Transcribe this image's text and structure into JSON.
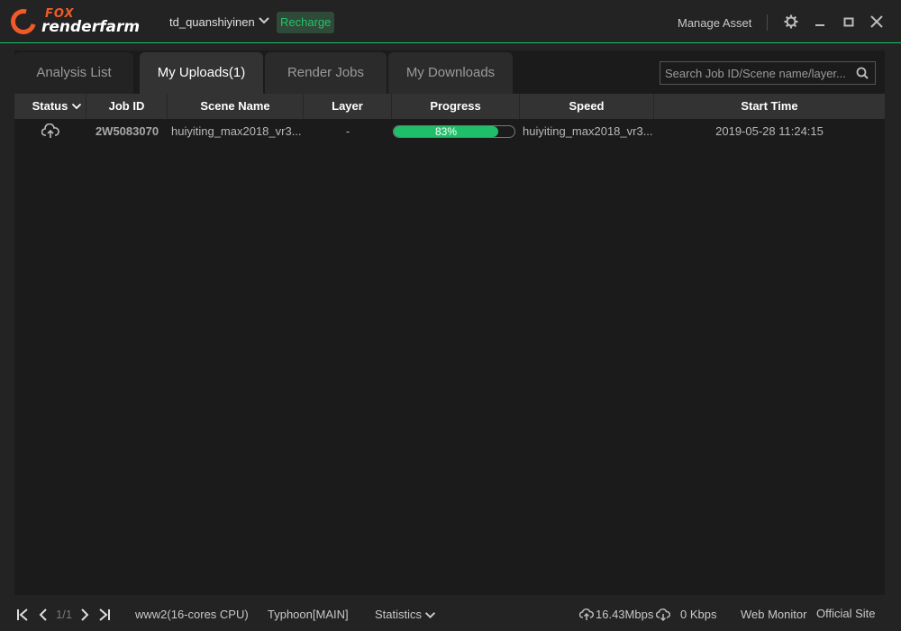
{
  "header": {
    "logo_top": "FOX",
    "logo_bottom": "renderfarm",
    "username": "td_quanshiyinen",
    "recharge_label": "Recharge",
    "manage_asset_label": "Manage Asset"
  },
  "tabs": [
    {
      "label": "Analysis List",
      "active": false
    },
    {
      "label": "My Uploads(1)",
      "active": true
    },
    {
      "label": "Render Jobs",
      "active": false
    },
    {
      "label": "My Downloads",
      "active": false
    }
  ],
  "search": {
    "placeholder": "Search Job ID/Scene name/layer..."
  },
  "table": {
    "columns": [
      "Status",
      "Job ID",
      "Scene Name",
      "Layer",
      "Progress",
      "Speed",
      "Start Time"
    ],
    "rows": [
      {
        "status_icon": "cloud-upload-icon",
        "job_id": "2W5083070",
        "scene_name": "huiyiting_max2018_vr3...",
        "layer": "-",
        "progress": 83,
        "progress_label": "83%",
        "speed": "huiyiting_max2018_vr3...",
        "start_time": "2019-05-28 11:24:15"
      }
    ]
  },
  "footer": {
    "page_indicator": "1/1",
    "server": "www2(16-cores CPU)",
    "platform": "Typhoon[MAIN]",
    "statistics_label": "Statistics",
    "upload_speed": "16.43Mbps",
    "download_speed": "0 Kbps",
    "web_monitor_label": "Web Monitor",
    "official_site_label": "Official Site"
  },
  "colors": {
    "accent": "#1fbf6a",
    "brand": "#f05a28",
    "background": "#232323"
  }
}
